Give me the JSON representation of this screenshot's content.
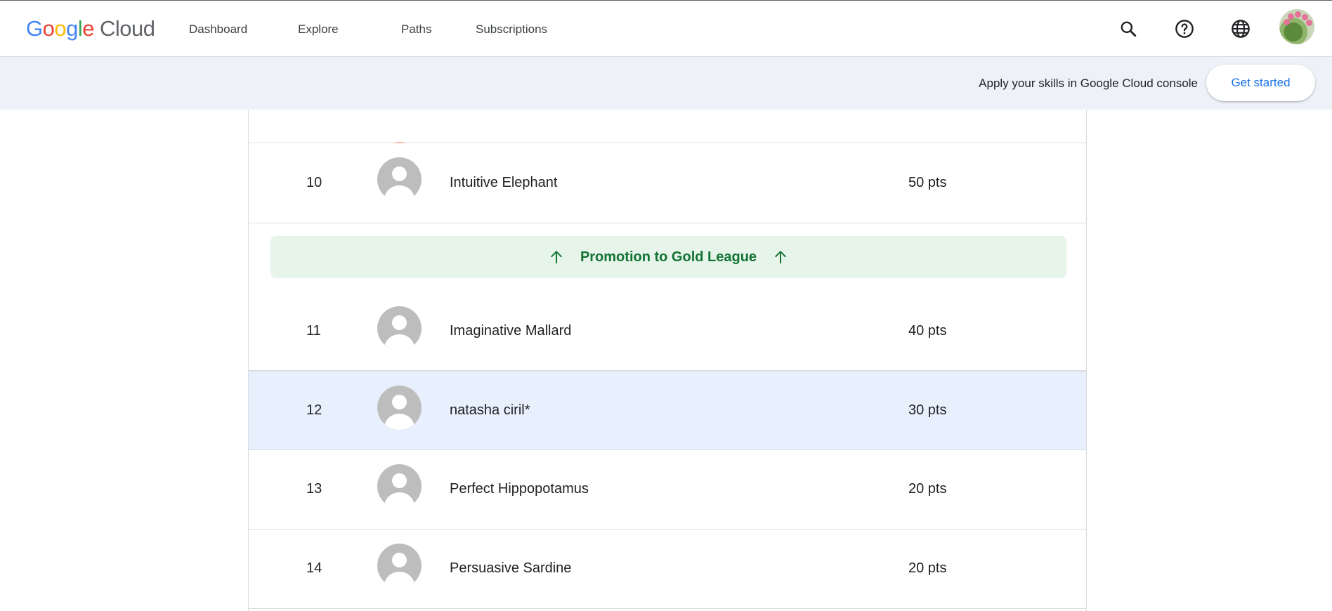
{
  "header": {
    "logo_text": "Google Cloud",
    "nav": {
      "dashboard": "Dashboard",
      "explore": "Explore",
      "paths": "Paths",
      "subscriptions": "Subscriptions"
    },
    "icons": [
      "search-icon",
      "help-icon",
      "globe-icon",
      "user-avatar"
    ]
  },
  "banner": {
    "text": "Apply your skills in Google Cloud console",
    "button_label": "Get started"
  },
  "leaderboard": {
    "rows": [
      {
        "rank": "10",
        "name": "Intuitive Elephant",
        "points": "50 pts"
      },
      {
        "rank": "11",
        "name": "Imaginative Mallard",
        "points": "40 pts"
      },
      {
        "rank": "12",
        "name": "natasha ciril*",
        "points": "30 pts"
      },
      {
        "rank": "13",
        "name": "Perfect Hippopotamus",
        "points": "20 pts"
      },
      {
        "rank": "14",
        "name": "Persuasive Sardine",
        "points": "20 pts"
      }
    ],
    "promotion_label": "Promotion to Gold League",
    "colors": {
      "promotion_bg": "#e6f4ea",
      "promotion_text": "#137333",
      "current_user_bg": "#e8f0fe"
    }
  }
}
